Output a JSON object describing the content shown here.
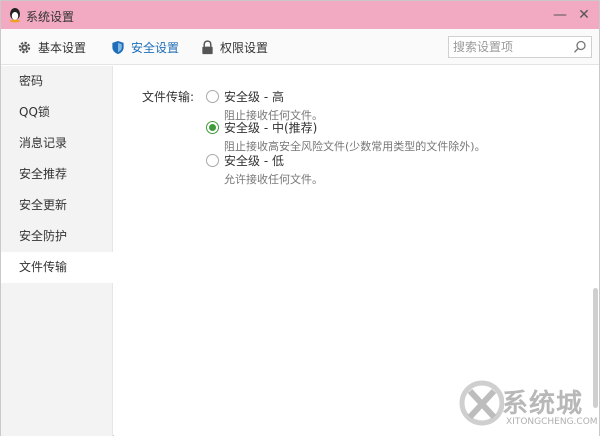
{
  "window": {
    "title": "系统设置"
  },
  "toolbar": {
    "tabs": [
      {
        "label": "基本设置",
        "icon": "gear-icon"
      },
      {
        "label": "安全设置",
        "icon": "shield-icon"
      },
      {
        "label": "权限设置",
        "icon": "lock-icon"
      }
    ],
    "active_tab": "安全设置",
    "search_placeholder": "搜索设置项"
  },
  "sidebar": {
    "items": [
      {
        "label": "密码"
      },
      {
        "label": "QQ锁"
      },
      {
        "label": "消息记录"
      },
      {
        "label": "安全推荐"
      },
      {
        "label": "安全更新"
      },
      {
        "label": "安全防护"
      },
      {
        "label": "文件传输"
      }
    ],
    "active_item": "文件传输"
  },
  "main": {
    "field_label": "文件传输:",
    "options": [
      {
        "title": "安全级 - 高",
        "desc": "阻止接收任何文件。",
        "checked": false
      },
      {
        "title": "安全级 - 中(推荐)",
        "desc": "阻止接收高安全风险文件(少数常用类型的文件除外)。",
        "checked": true
      },
      {
        "title": "安全级 - 低",
        "desc": "允许接收任何文件。",
        "checked": false
      }
    ]
  },
  "colors": {
    "titlebar": "#f2a9c2",
    "active_tab": "#1e6fb8",
    "radio_checked": "#3f9b3a"
  },
  "watermark": {
    "text": "系统城",
    "sub": "XITONGCHENG.COM"
  }
}
